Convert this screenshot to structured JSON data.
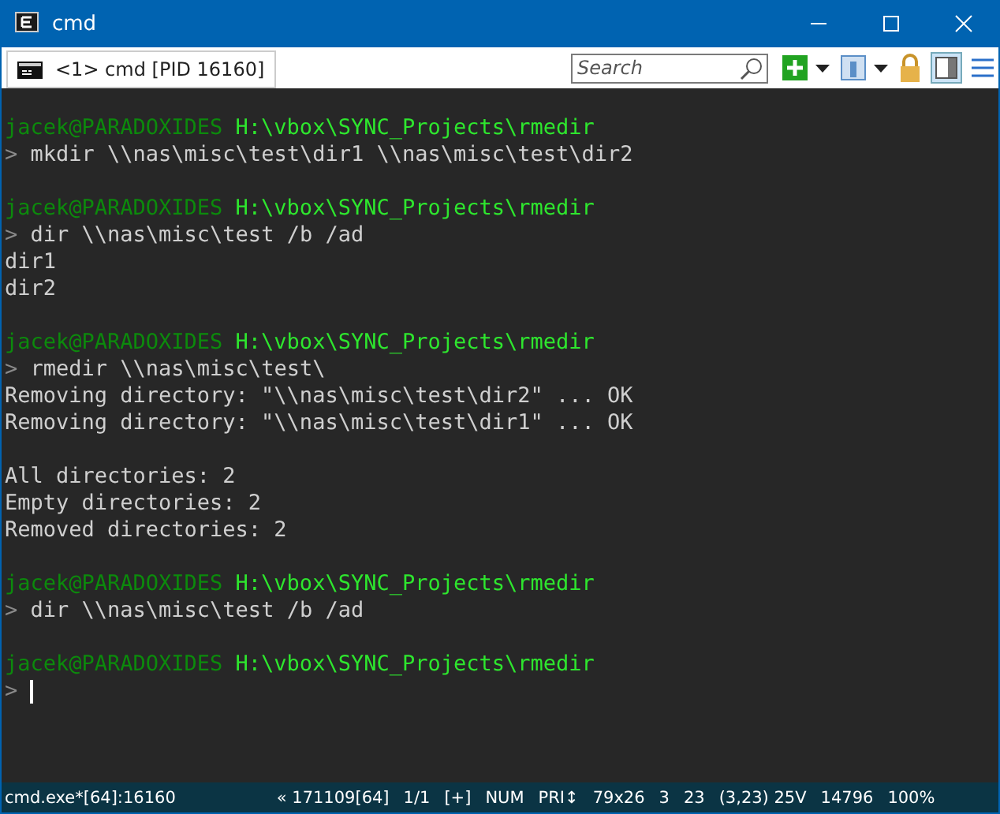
{
  "window": {
    "title": "cmd"
  },
  "tabs": [
    {
      "label": "<1> cmd [PID 16160]",
      "selected": true
    }
  ],
  "search": {
    "placeholder": "Search"
  },
  "console": [
    {
      "kind": "blank"
    },
    {
      "kind": "prompt",
      "user": "jacek@PARADOXIDES",
      "path": "H:\\vbox\\SYNC_Projects\\rmedir"
    },
    {
      "kind": "command",
      "mark": ">",
      "text": "mkdir \\\\nas\\misc\\test\\dir1 \\\\nas\\misc\\test\\dir2"
    },
    {
      "kind": "blank"
    },
    {
      "kind": "prompt",
      "user": "jacek@PARADOXIDES",
      "path": "H:\\vbox\\SYNC_Projects\\rmedir"
    },
    {
      "kind": "command",
      "mark": ">",
      "text": "dir \\\\nas\\misc\\test /b /ad"
    },
    {
      "kind": "output",
      "text": "dir1"
    },
    {
      "kind": "output",
      "text": "dir2"
    },
    {
      "kind": "blank"
    },
    {
      "kind": "prompt",
      "user": "jacek@PARADOXIDES",
      "path": "H:\\vbox\\SYNC_Projects\\rmedir"
    },
    {
      "kind": "command",
      "mark": ">",
      "text": "rmedir \\\\nas\\misc\\test\\"
    },
    {
      "kind": "output",
      "text": "Removing directory: \"\\\\nas\\misc\\test\\dir2\" ... OK"
    },
    {
      "kind": "output",
      "text": "Removing directory: \"\\\\nas\\misc\\test\\dir1\" ... OK"
    },
    {
      "kind": "blank"
    },
    {
      "kind": "output",
      "text": "All directories: 2"
    },
    {
      "kind": "output",
      "text": "Empty directories: 2"
    },
    {
      "kind": "output",
      "text": "Removed directories: 2"
    },
    {
      "kind": "blank"
    },
    {
      "kind": "prompt",
      "user": "jacek@PARADOXIDES",
      "path": "H:\\vbox\\SYNC_Projects\\rmedir"
    },
    {
      "kind": "command",
      "mark": ">",
      "text": "dir \\\\nas\\misc\\test /b /ad"
    },
    {
      "kind": "blank"
    },
    {
      "kind": "prompt",
      "user": "jacek@PARADOXIDES",
      "path": "H:\\vbox\\SYNC_Projects\\rmedir"
    },
    {
      "kind": "cursor",
      "mark": ">"
    }
  ],
  "status_bar": [
    "cmd.exe*[64]:16160",
    "« 171109[64]",
    "1/1",
    "[+]",
    "NUM",
    "PRI↕",
    "79x26",
    "3",
    "23",
    "(3,23) 25V",
    "14796",
    "100%"
  ]
}
